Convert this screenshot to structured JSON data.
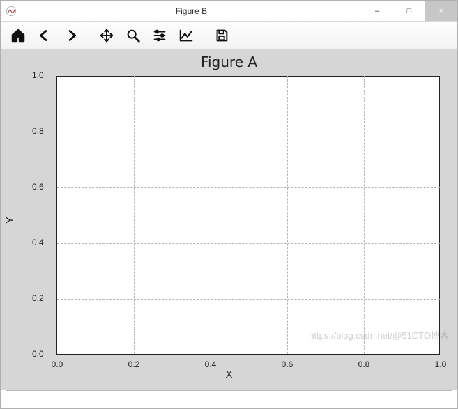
{
  "window": {
    "title": "Figure B",
    "buttons": {
      "min": "–",
      "max": "□",
      "close": "×"
    }
  },
  "toolbar": {
    "items": [
      {
        "name": "home-icon"
      },
      {
        "name": "back-icon"
      },
      {
        "name": "forward-icon"
      },
      {
        "sep": true
      },
      {
        "name": "pan-icon"
      },
      {
        "name": "zoom-icon"
      },
      {
        "name": "configure-icon"
      },
      {
        "name": "edit-axes-icon"
      },
      {
        "sep": true
      },
      {
        "name": "save-icon"
      }
    ]
  },
  "chart_data": {
    "type": "line",
    "title": "Figure A",
    "xlabel": "X",
    "ylabel": "Y",
    "xlim": [
      0.0,
      1.0
    ],
    "ylim": [
      0.0,
      1.0
    ],
    "xticks": [
      0.0,
      0.2,
      0.4,
      0.6,
      0.8,
      1.0
    ],
    "yticks": [
      0.0,
      0.2,
      0.4,
      0.6,
      0.8,
      1.0
    ],
    "xticklabels": [
      "0.0",
      "0.2",
      "0.4",
      "0.6",
      "0.8",
      "1.0"
    ],
    "yticklabels": [
      "0.0",
      "0.2",
      "0.4",
      "0.6",
      "0.8",
      "1.0"
    ],
    "grid": true,
    "grid_style": "dashed",
    "series": []
  },
  "watermark": "https://blog.csdn.net/@51CTO博客"
}
